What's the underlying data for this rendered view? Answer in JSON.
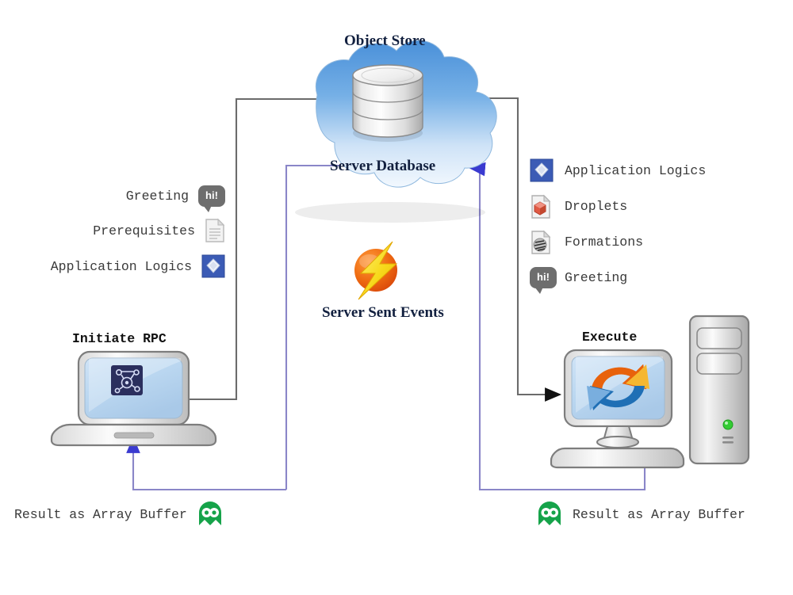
{
  "diagram": {
    "title": "RPC over Server Database architecture flow",
    "colors": {
      "gray_connector": "#6b6b6b",
      "purple_connector": "#8a86c8",
      "cloud_top": "#4a90d9",
      "cloud_bottom": "#eaf2fb",
      "green_icon": "#16a34a",
      "accent_orange": "#e8620c",
      "accent_yellow": "#f6d117",
      "bubble_gray": "#6e6e6e",
      "app_logic_blue": "#3b5bb5",
      "led_green": "#33cc33"
    }
  },
  "nodes": {
    "object_store": {
      "label": "Object Store",
      "icon": "database-cylinder-icon"
    },
    "server_database": {
      "label": "Server Database",
      "icon": "cloud-icon"
    },
    "server_sent_events": {
      "label": "Server Sent Events",
      "icon": "lightning-bolt-icon"
    },
    "initiate_rpc": {
      "label": "Initiate RPC",
      "icon": "laptop-icon",
      "screen_icon": "network-graph-icon"
    },
    "execute": {
      "label": "Execute",
      "icon": "monitor-icon",
      "screen_icon": "refresh-cycle-icon",
      "tower_icon": "server-tower-icon"
    }
  },
  "left_payload": {
    "items": [
      {
        "label": "Greeting",
        "icon": "speech-bubble-hi-icon"
      },
      {
        "label": "Prerequisites",
        "icon": "document-icon"
      },
      {
        "label": "Application Logics",
        "icon": "application-logics-icon"
      }
    ]
  },
  "right_payload": {
    "items": [
      {
        "label": "Application Logics",
        "icon": "application-logics-icon"
      },
      {
        "label": "Droplets",
        "icon": "droplets-document-icon"
      },
      {
        "label": "Formations",
        "icon": "formations-document-icon"
      },
      {
        "label": "Greeting",
        "icon": "speech-bubble-hi-icon"
      }
    ]
  },
  "results": {
    "left": {
      "label": "Result as Array Buffer",
      "icon": "green-monster-icon"
    },
    "right": {
      "label": "Result as Array Buffer",
      "icon": "green-monster-icon"
    }
  }
}
